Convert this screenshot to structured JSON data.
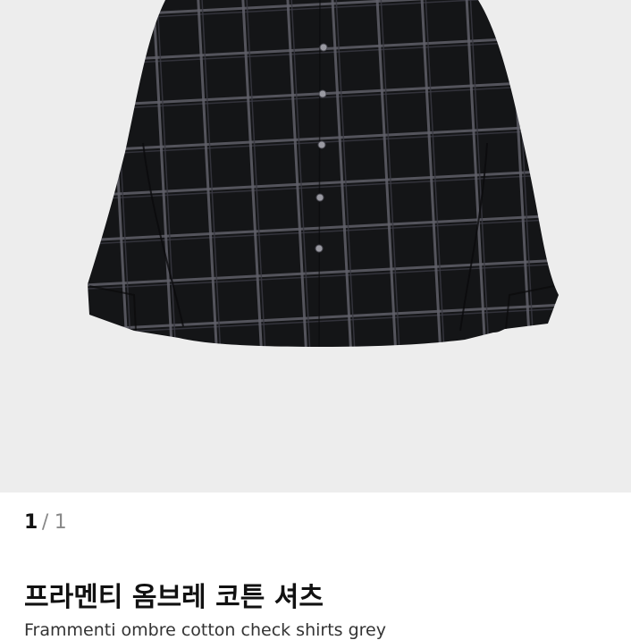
{
  "product": {
    "image_alt": "frammenti ombre cotton check shirt",
    "pager": {
      "current": "1",
      "separator": "/",
      "total": "1"
    },
    "title": "프라멘티 옴브레 코튼 셔츠",
    "subtitle": "Frammenti ombre cotton check shirts grey"
  },
  "colors": {
    "image_background": "#ededed",
    "shirt": "#141517",
    "check_lines": "#6e6e78"
  }
}
